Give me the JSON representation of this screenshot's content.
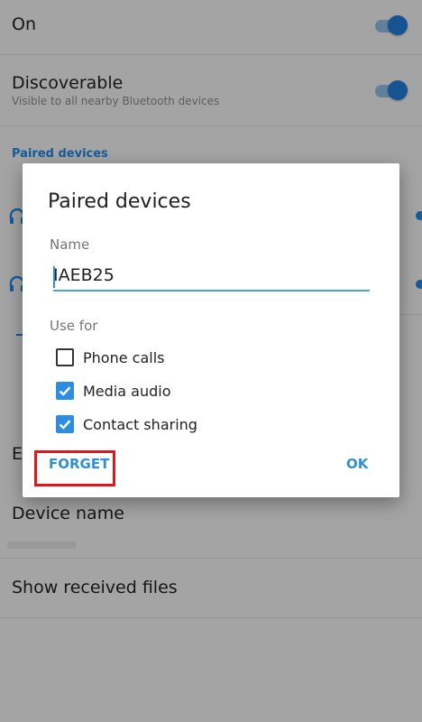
{
  "settings": {
    "on_row": {
      "title": "On",
      "toggle_on": true
    },
    "discoverable_row": {
      "title": "Discoverable",
      "subtitle": "Visible to all nearby Bluetooth devices",
      "toggle_on": true
    },
    "paired_header": "Paired devices",
    "paired_items": [
      {
        "icon": "headphones-icon"
      },
      {
        "icon": "headphones-icon"
      }
    ],
    "partial_letter": "E",
    "device_name_row": {
      "title": "Device name"
    },
    "received_files_row": {
      "title": "Show received files"
    }
  },
  "dialog": {
    "title": "Paired devices",
    "name_label": "Name",
    "name_value": "IAEB25",
    "use_for_label": "Use for",
    "options": [
      {
        "label": "Phone calls",
        "checked": false
      },
      {
        "label": "Media audio",
        "checked": true
      },
      {
        "label": "Contact sharing",
        "checked": true
      }
    ],
    "forget_label": "FORGET",
    "ok_label": "OK",
    "forget_highlighted": true
  },
  "colors": {
    "accent": "#1e88e5",
    "toggle_thumb": "#1f7bd6",
    "checkbox_checked": "#2d8ee0",
    "highlight_box": "#e0161b"
  }
}
